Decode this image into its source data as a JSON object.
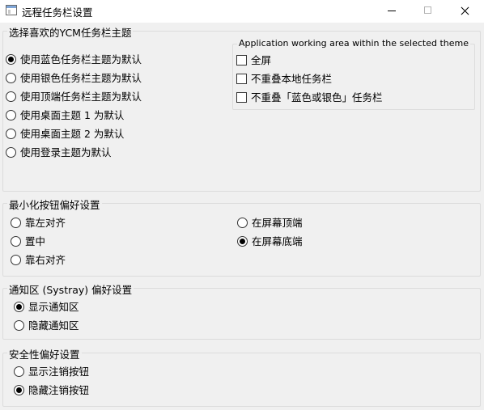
{
  "window": {
    "title": "远程任务栏设置"
  },
  "theme_group": {
    "legend": "选择喜欢的YCM任务栏主题",
    "options": [
      {
        "label": "使用蓝色任务栏主题为默认",
        "checked": true
      },
      {
        "label": "使用银色任务栏主题为默认",
        "checked": false
      },
      {
        "label": "使用顶端任务栏主题为默认",
        "checked": false
      },
      {
        "label": "使用桌面主题 1 为默认",
        "checked": false
      },
      {
        "label": "使用桌面主题 2 为默认",
        "checked": false
      },
      {
        "label": "使用登录主题为默认",
        "checked": false
      }
    ],
    "working_area": {
      "legend": "Application working area within the selected theme",
      "checks": [
        {
          "label": "全屏",
          "checked": false
        },
        {
          "label": "不重叠本地任务栏",
          "checked": false
        },
        {
          "label": "不重叠「蓝色或银色」任务栏",
          "checked": false
        }
      ]
    }
  },
  "minimize_group": {
    "legend": "最小化按钮偏好设置",
    "left_options": [
      {
        "label": "靠左对齐",
        "checked": false
      },
      {
        "label": "置中",
        "checked": false
      },
      {
        "label": "靠右对齐",
        "checked": false
      }
    ],
    "right_options": [
      {
        "label": "在屏幕顶端",
        "checked": false
      },
      {
        "label": "在屏幕底端",
        "checked": true
      }
    ]
  },
  "systray_group": {
    "legend": "通知区 (Systray) 偏好设置",
    "options": [
      {
        "label": "显示通知区",
        "checked": true
      },
      {
        "label": "隐藏通知区",
        "checked": false
      }
    ]
  },
  "security_group": {
    "legend": "安全性偏好设置",
    "options": [
      {
        "label": "显示注销按钮",
        "checked": false
      },
      {
        "label": "隐藏注销按钮",
        "checked": true
      }
    ]
  }
}
